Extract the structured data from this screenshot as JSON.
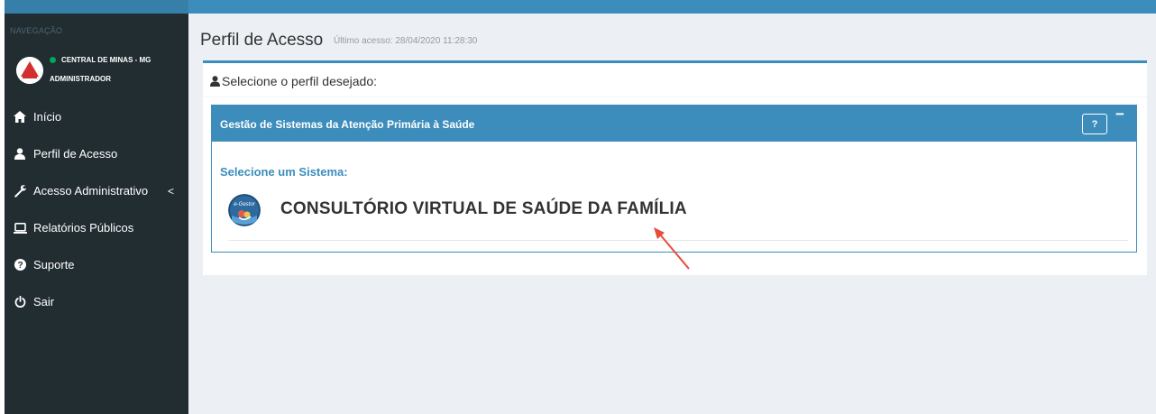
{
  "sidebar": {
    "nav_header": "NAVEGAÇÃO",
    "user": {
      "line1": "CENTRAL DE MINAS - MG",
      "line2": "ADMINISTRADOR",
      "status_color": "#00a65a"
    },
    "items": [
      {
        "label": "Início",
        "icon": "home-icon"
      },
      {
        "label": "Perfil de Acesso",
        "icon": "user-icon"
      },
      {
        "label": "Acesso Administrativo",
        "icon": "wrench-icon",
        "has_submenu": true
      },
      {
        "label": "Relatórios Públicos",
        "icon": "laptop-icon"
      },
      {
        "label": "Suporte",
        "icon": "question-circle-icon"
      },
      {
        "label": "Sair",
        "icon": "power-icon"
      }
    ],
    "submenu_chevron": "<"
  },
  "header": {
    "title": "Perfil de Acesso",
    "subtitle": "Último acesso: 28/04/2020 11:28:30"
  },
  "box": {
    "header_text": "Selecione o perfil desejado:"
  },
  "panel": {
    "title": "Gestão de Sistemas da Atenção Primária à Saúde",
    "help_label": "?",
    "minimize_label": "−",
    "select_label": "Selecione um Sistema:",
    "system_name": "CONSULTÓRIO VIRTUAL DE SAÚDE DA FAMÍLIA",
    "system_logo_text": "e-Gestor"
  },
  "colors": {
    "sidebar_bg": "#222d32",
    "accent": "#3c8dbc",
    "content_bg": "#ecf0f5",
    "arrow": "#e74c3c"
  }
}
